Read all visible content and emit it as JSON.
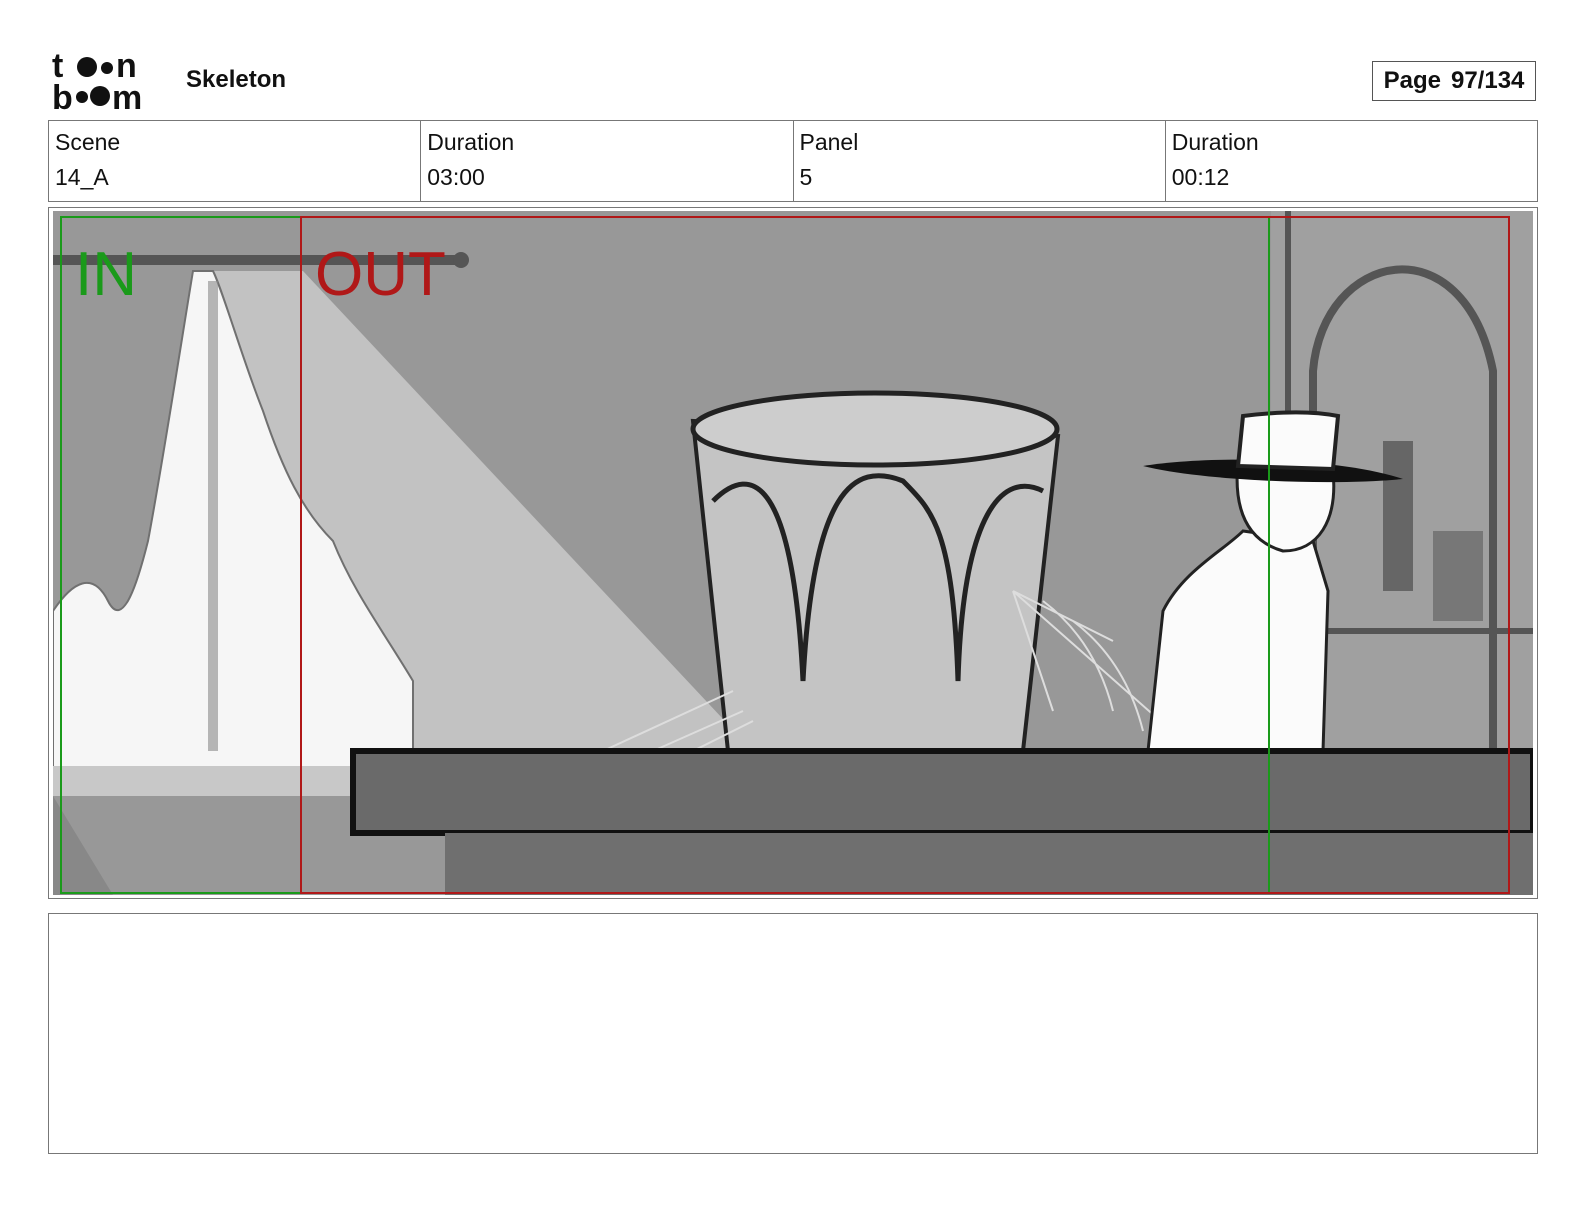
{
  "header": {
    "logo_text": "toon boom",
    "project_title": "Skeleton",
    "page_label": "Page",
    "page_number": "97/134"
  },
  "info": {
    "scene_label": "Scene",
    "scene_value": "14_A",
    "scene_duration_label": "Duration",
    "scene_duration_value": "03:00",
    "panel_label": "Panel",
    "panel_value": "5",
    "panel_duration_label": "Duration",
    "panel_duration_value": "00:12"
  },
  "panel": {
    "in_marker": "IN",
    "out_marker": "OUT",
    "colors": {
      "in": "#1a9a1a",
      "out": "#b01818",
      "background": "#989898"
    }
  },
  "notes": {
    "text": ""
  }
}
